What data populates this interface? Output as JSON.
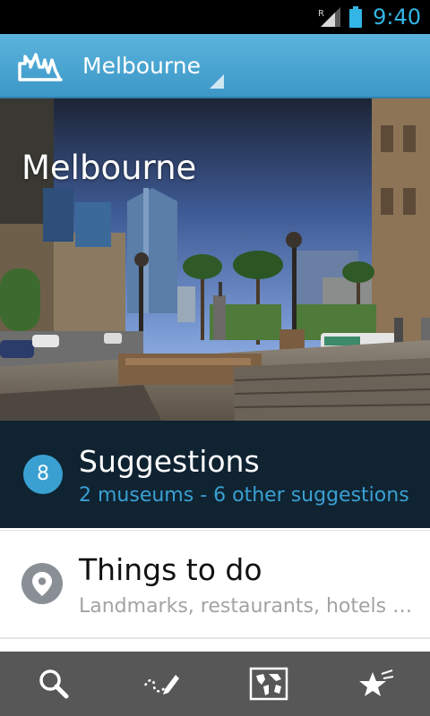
{
  "status_bar": {
    "time": "9:40",
    "roaming_label": "R",
    "accent_color": "#33b5e5"
  },
  "action_bar": {
    "app_icon": "city-skyline-icon",
    "city_name": "Melbourne",
    "background_color": "#4aa8d8"
  },
  "hero": {
    "title": "Melbourne",
    "image": "melbourne-city-square-photo"
  },
  "suggestions": {
    "count": "8",
    "title": "Suggestions",
    "subtitle": "2 museums - 6 other suggestions",
    "background_color": "#0f2331",
    "accent_color": "#3aa0d2"
  },
  "things_to_do": {
    "icon": "map-pin-icon",
    "title": "Things to do",
    "subtitle": "Landmarks, restaurants, hotels …"
  },
  "bottom_bar": {
    "tabs": [
      {
        "icon": "search-icon"
      },
      {
        "icon": "pencil-route-icon"
      },
      {
        "icon": "world-map-icon"
      },
      {
        "icon": "star-favorites-icon"
      }
    ]
  }
}
